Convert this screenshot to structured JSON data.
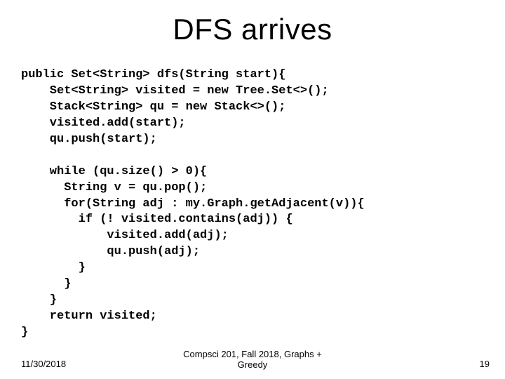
{
  "title": "DFS arrives",
  "code": {
    "l01": "public Set<String> dfs(String start){",
    "l02": "    Set<String> visited = new Tree.Set<>();",
    "l03": "    Stack<String> qu = new Stack<>();",
    "l04": "    visited.add(start);",
    "l05": "    qu.push(start);",
    "l06": "",
    "l07": "    while (qu.size() > 0){",
    "l08": "      String v = qu.pop();",
    "l09": "      for(String adj : my.Graph.getAdjacent(v)){",
    "l10": "        if (! visited.contains(adj)) {",
    "l11": "            visited.add(adj);",
    "l12": "            qu.push(adj);",
    "l13": "        }",
    "l14": "      }",
    "l15": "    }",
    "l16": "    return visited;",
    "l17": "}"
  },
  "footer": {
    "date": "11/30/2018",
    "center_line1": "Compsci 201, Fall 2018,  Graphs +",
    "center_line2": "Greedy",
    "page": "19"
  }
}
